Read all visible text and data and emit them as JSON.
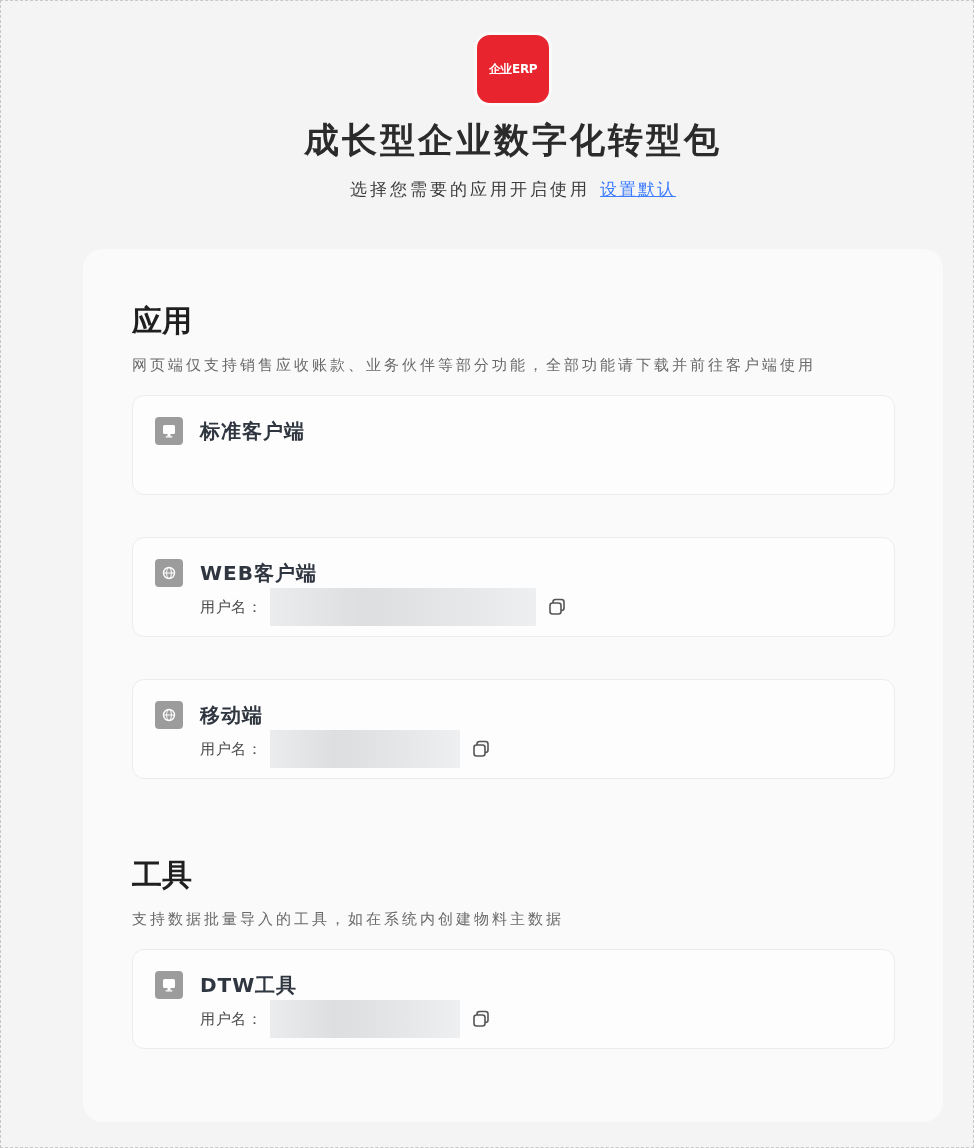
{
  "logo": {
    "text": "企业ERP"
  },
  "title": "成长型企业数字化转型包",
  "subtitle": {
    "text": "选择您需要的应用开启使用",
    "link": "设置默认"
  },
  "sections": [
    {
      "heading": "应用",
      "description": "网页端仅支持销售应收账款、业务伙伴等部分功能，全部功能请下载并前往客户端使用",
      "items": [
        {
          "kind": "desktop",
          "name": "标准客户端"
        },
        {
          "kind": "web",
          "name": "WEB客户端",
          "username_label": "用户名：",
          "username_masked": true
        },
        {
          "kind": "web",
          "name": "移动端",
          "username_label": "用户名：",
          "username_masked": true
        }
      ]
    },
    {
      "heading": "工具",
      "description": "支持数据批量导入的工具，如在系统内创建物料主数据",
      "items": [
        {
          "kind": "desktop",
          "name": "DTW工具",
          "username_label": "用户名：",
          "username_masked": true
        }
      ]
    }
  ]
}
